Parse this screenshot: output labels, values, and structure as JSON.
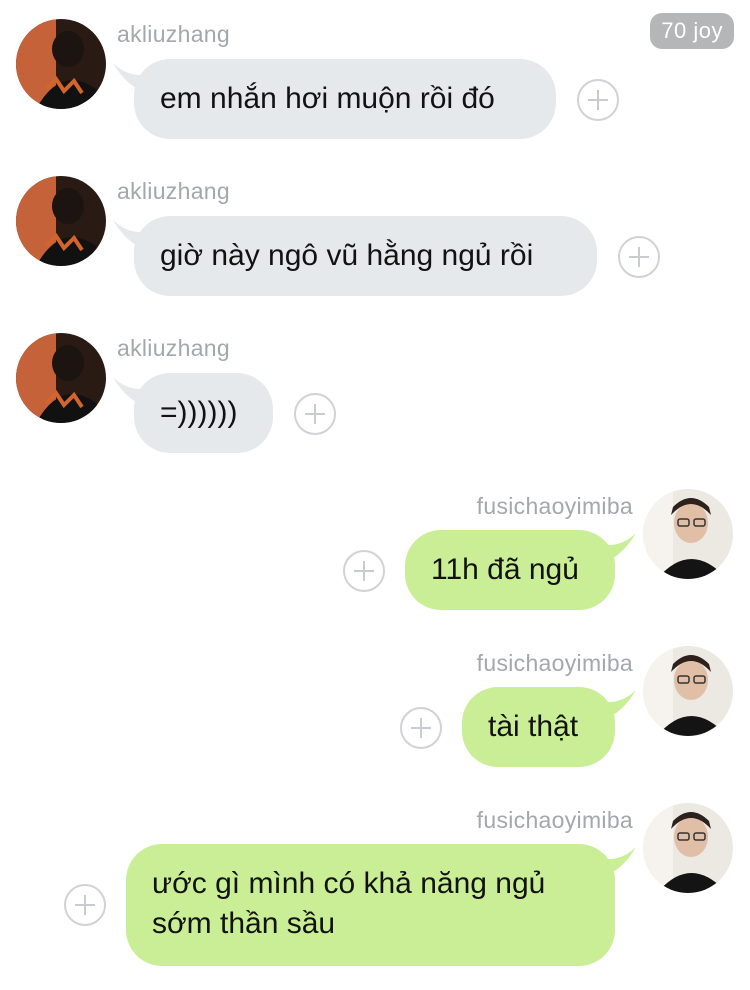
{
  "badge": {
    "text": "70 joy"
  },
  "messages": [
    {
      "sender": "akliuzhang",
      "text": "em nhắn hơi muộn rồi đó",
      "direction": "incoming"
    },
    {
      "sender": "akliuzhang",
      "text": "giờ này ngô vũ hằng ngủ rồi",
      "direction": "incoming"
    },
    {
      "sender": "akliuzhang",
      "text": "=))))))",
      "direction": "incoming"
    },
    {
      "sender": "fusichaoyimiba",
      "text": "11h đã ngủ",
      "direction": "outgoing"
    },
    {
      "sender": "fusichaoyimiba",
      "text": "tài thật",
      "direction": "outgoing"
    },
    {
      "sender": "fusichaoyimiba",
      "text": "ước gì mình có khả năng ngủ sớm thần sầu",
      "direction": "outgoing"
    }
  ],
  "colors": {
    "incoming_bubble": "#e6e9ec",
    "outgoing_bubble": "#c9ee96",
    "username": "#a4a7ab",
    "badge_bg": "#b5b6b8"
  },
  "icons": {
    "react": "add-reaction-icon",
    "avatar_incoming": "user-avatar",
    "avatar_outgoing": "user-avatar"
  }
}
